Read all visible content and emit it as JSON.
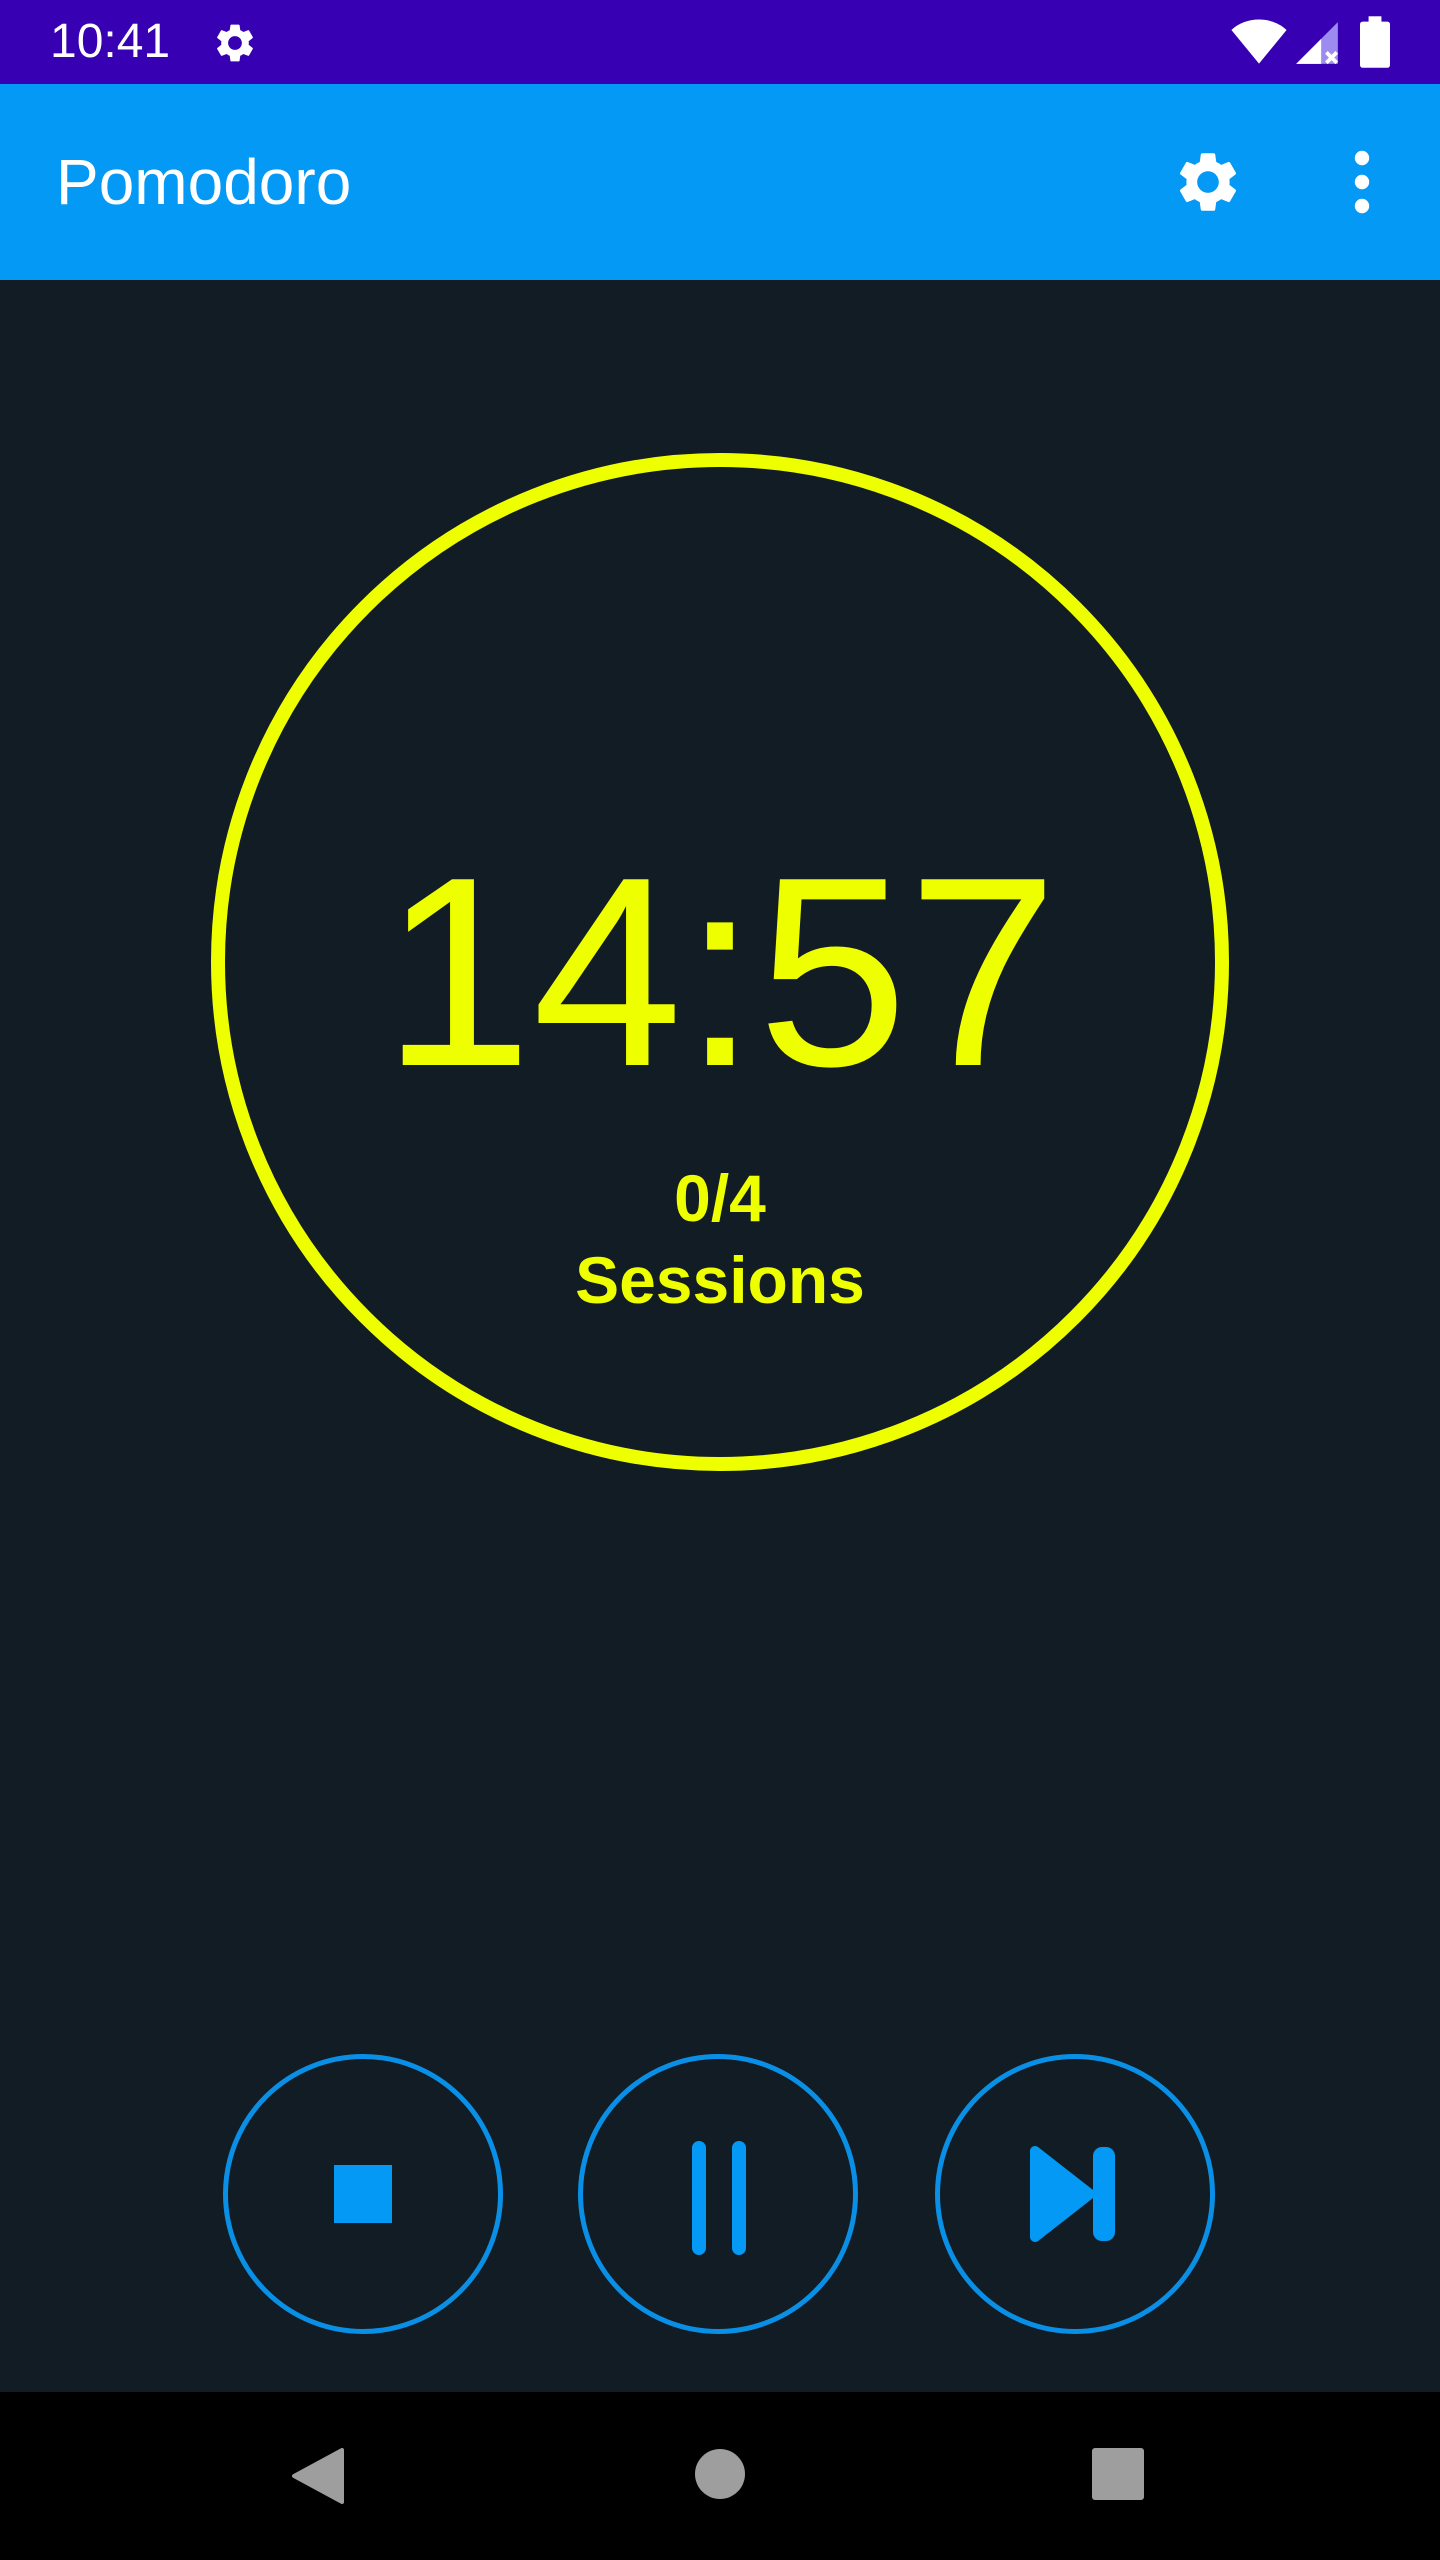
{
  "status_bar": {
    "time": "10:41",
    "icons": [
      "gear-icon",
      "wifi-icon",
      "cell-signal-icon",
      "battery-icon"
    ]
  },
  "app_bar": {
    "title": "Pomodoro",
    "actions": [
      "gear-icon",
      "more-vert-icon"
    ]
  },
  "timer": {
    "time_remaining": "14:57",
    "sessions_completed": "0/4",
    "sessions_label": "Sessions"
  },
  "controls": {
    "buttons": [
      "stop-icon",
      "pause-icon",
      "skip-next-icon"
    ]
  },
  "nav_bar": {
    "buttons": [
      "back-icon",
      "home-icon",
      "recents-icon"
    ]
  },
  "colors": {
    "status_bar": "#3700b3",
    "app_bar": "#0399f4",
    "background": "#111c24",
    "timer_accent": "#eeff00",
    "control_accent": "#0a8fe6",
    "nav_bar": "#000000"
  }
}
